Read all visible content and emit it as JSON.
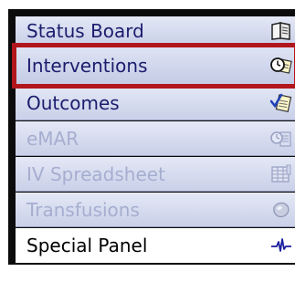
{
  "menu": {
    "items": [
      {
        "label": "Status Board",
        "icon": "book-icon",
        "state": "enabled"
      },
      {
        "label": "Interventions",
        "icon": "clock-notepad-icon",
        "state": "selected"
      },
      {
        "label": "Outcomes",
        "icon": "checkmark-notepad-icon",
        "state": "enabled"
      },
      {
        "label": "eMAR",
        "icon": "clock-card-icon",
        "state": "disabled"
      },
      {
        "label": "IV Spreadsheet",
        "icon": "spreadsheet-icon",
        "state": "disabled"
      },
      {
        "label": "Transfusions",
        "icon": "blood-bag-icon",
        "state": "disabled"
      },
      {
        "label": "Special Panel",
        "icon": "heartbeat-icon",
        "state": "enabled"
      }
    ]
  },
  "colors": {
    "selection_outline": "#b1161c",
    "enabled_text": "#1b1d6d",
    "disabled_text": "#a6aed0",
    "panel_border": "#0c0c0c"
  }
}
